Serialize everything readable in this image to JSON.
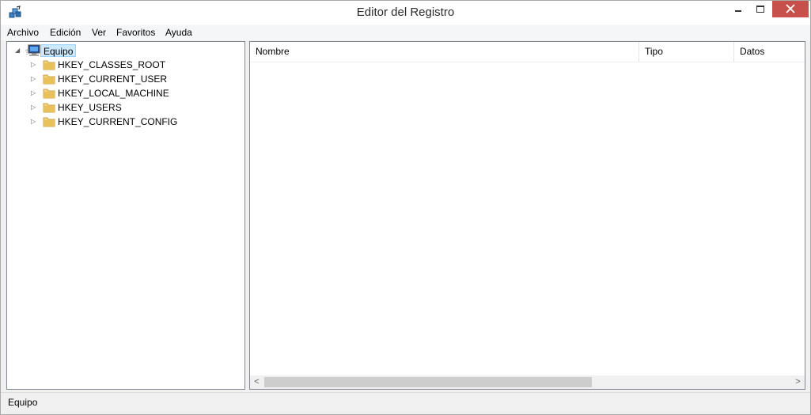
{
  "window": {
    "title": "Editor del Registro"
  },
  "menu": [
    "Archivo",
    "Edición",
    "Ver",
    "Favoritos",
    "Ayuda"
  ],
  "tree": {
    "root": {
      "label": "Equipo",
      "icon": "computer-icon",
      "expanded": true,
      "selected": true
    },
    "children": [
      {
        "label": "HKEY_CLASSES_ROOT",
        "icon": "folder-icon"
      },
      {
        "label": "HKEY_CURRENT_USER",
        "icon": "folder-icon"
      },
      {
        "label": "HKEY_LOCAL_MACHINE",
        "icon": "folder-icon"
      },
      {
        "label": "HKEY_USERS",
        "icon": "folder-icon"
      },
      {
        "label": "HKEY_CURRENT_CONFIG",
        "icon": "folder-icon"
      }
    ]
  },
  "list": {
    "columns": [
      "Nombre",
      "Tipo",
      "Datos"
    ],
    "rows": []
  },
  "status": {
    "text": "Equipo"
  },
  "colors": {
    "close_button": "#c7504a",
    "selection_bg": "#cce8ff",
    "folder": "#e8c15a"
  }
}
